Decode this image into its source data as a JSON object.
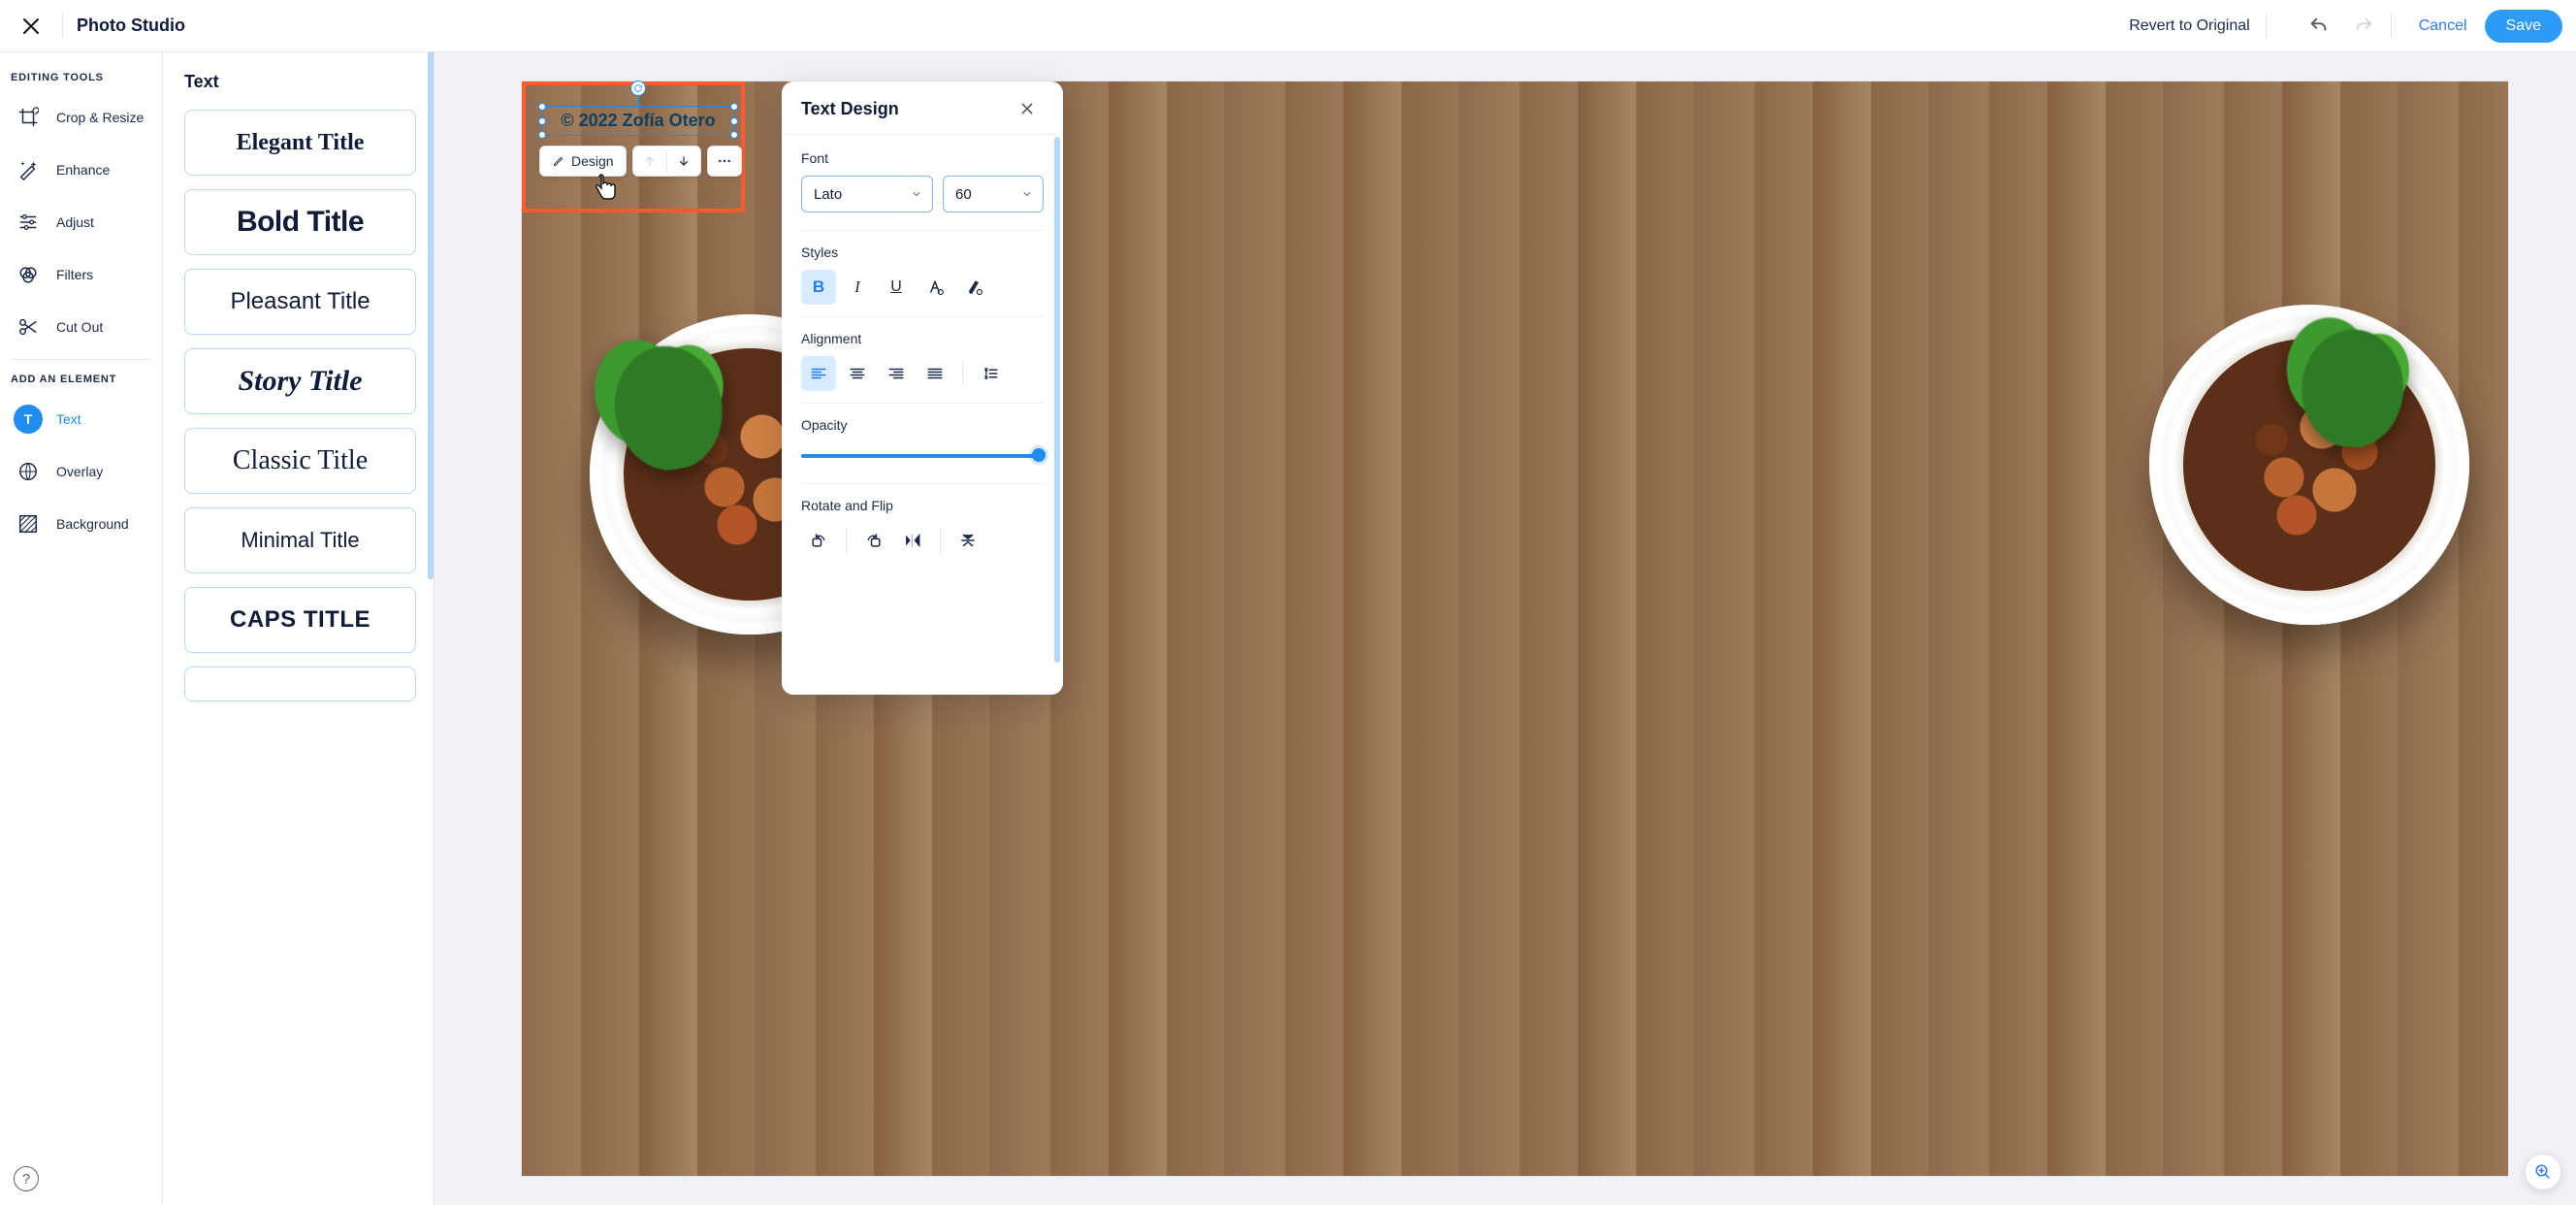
{
  "header": {
    "app_title": "Photo Studio",
    "revert_label": "Revert to Original",
    "cancel_label": "Cancel",
    "save_label": "Save"
  },
  "left_rail": {
    "section_editing": "EDITING TOOLS",
    "section_add": "ADD AN ELEMENT",
    "crop": "Crop & Resize",
    "enhance": "Enhance",
    "adjust": "Adjust",
    "filters": "Filters",
    "cutout": "Cut Out",
    "text": "Text",
    "overlay": "Overlay",
    "background": "Background"
  },
  "styles_panel": {
    "heading": "Text",
    "presets": {
      "elegant": "Elegant Title",
      "bold": "Bold Title",
      "pleasant": "Pleasant Title",
      "story": "Story Title",
      "classic": "Classic Title",
      "minimal": "Minimal Title",
      "caps": "CAPS TITLE"
    }
  },
  "canvas": {
    "text_value": "© 2022 Zofía Otero",
    "mini_toolbar": {
      "design": "Design"
    }
  },
  "design_panel": {
    "title": "Text Design",
    "font_label": "Font",
    "font_value": "Lato",
    "size_value": "60",
    "styles_label": "Styles",
    "alignment_label": "Alignment",
    "opacity_label": "Opacity",
    "rotate_label": "Rotate and Flip"
  }
}
